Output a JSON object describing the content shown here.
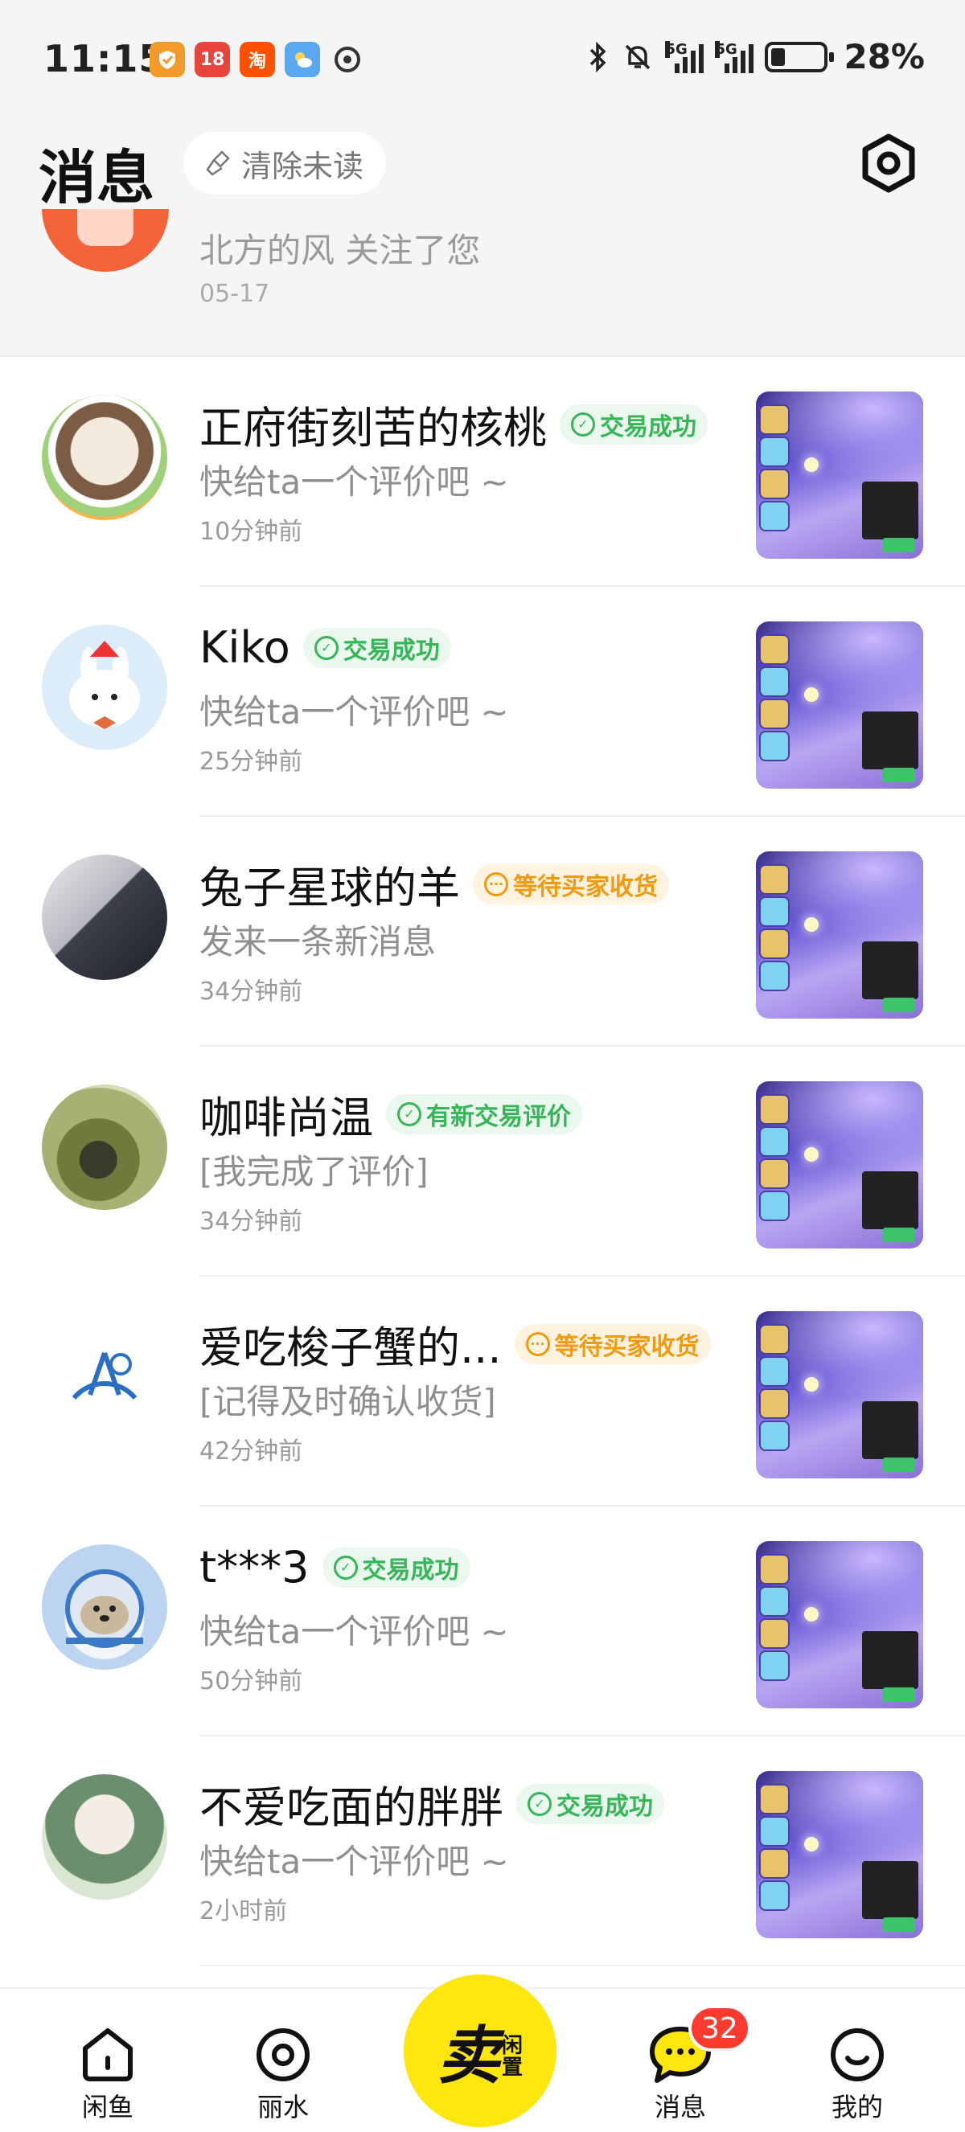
{
  "status_bar": {
    "time": "11:15",
    "apps": [
      "18",
      "淘"
    ],
    "signal_label": "5G",
    "battery": "28%",
    "battery_level": 0.28
  },
  "header": {
    "title": "消息",
    "clear_unread_label": "清除未读",
    "icons": {
      "clear": "broom-icon",
      "settings": "settings-hexagon-icon"
    }
  },
  "top_item": {
    "text": "北方的风 关注了您",
    "time": "05-17"
  },
  "conversations": [
    {
      "name": "正府街刻苦的核桃",
      "badge": "交易成功",
      "badge_color": "#37b559",
      "message": "快给ta一个评价吧 ~",
      "time": "10分钟前"
    },
    {
      "name": "Kiko",
      "badge": "交易成功",
      "badge_color": "#37b559",
      "message": "快给ta一个评价吧 ~",
      "time": "25分钟前"
    },
    {
      "name": "兔子星球的羊",
      "badge": "等待买家收货",
      "badge_color": "#f29a0e",
      "message": "发来一条新消息",
      "time": "34分钟前"
    },
    {
      "name": "咖啡尚温",
      "badge": "有新交易评价",
      "badge_color": "#37b559",
      "message": "[我完成了评价]",
      "time": "34分钟前"
    },
    {
      "name": "爱吃梭子蟹的...",
      "badge": "等待买家收货",
      "badge_color": "#f29a0e",
      "message": "[记得及时确认收货]",
      "time": "42分钟前"
    },
    {
      "name": "t***3",
      "badge": "交易成功",
      "badge_color": "#37b559",
      "message": "快给ta一个评价吧 ~",
      "time": "50分钟前"
    },
    {
      "name": "不爱吃面的胖胖",
      "badge": "交易成功",
      "badge_color": "#37b559",
      "message": "快给ta一个评价吧 ~",
      "time": "2小时前"
    }
  ],
  "tab_bar": {
    "tabs": [
      {
        "label": "闲鱼",
        "icon": "home-icon"
      },
      {
        "label": "丽水",
        "icon": "location-icon"
      },
      {
        "label": "消息",
        "icon": "message-icon"
      },
      {
        "label": "我的",
        "icon": "profile-icon"
      }
    ],
    "sell": {
      "main": "卖",
      "sub1": "闲",
      "sub2": "置"
    },
    "unread_count": "32"
  },
  "colors": {
    "accent_yellow": "#ffe60f",
    "success_green": "#37b559",
    "pending_orange": "#f29a0e",
    "unread_red": "#ff3b30"
  }
}
